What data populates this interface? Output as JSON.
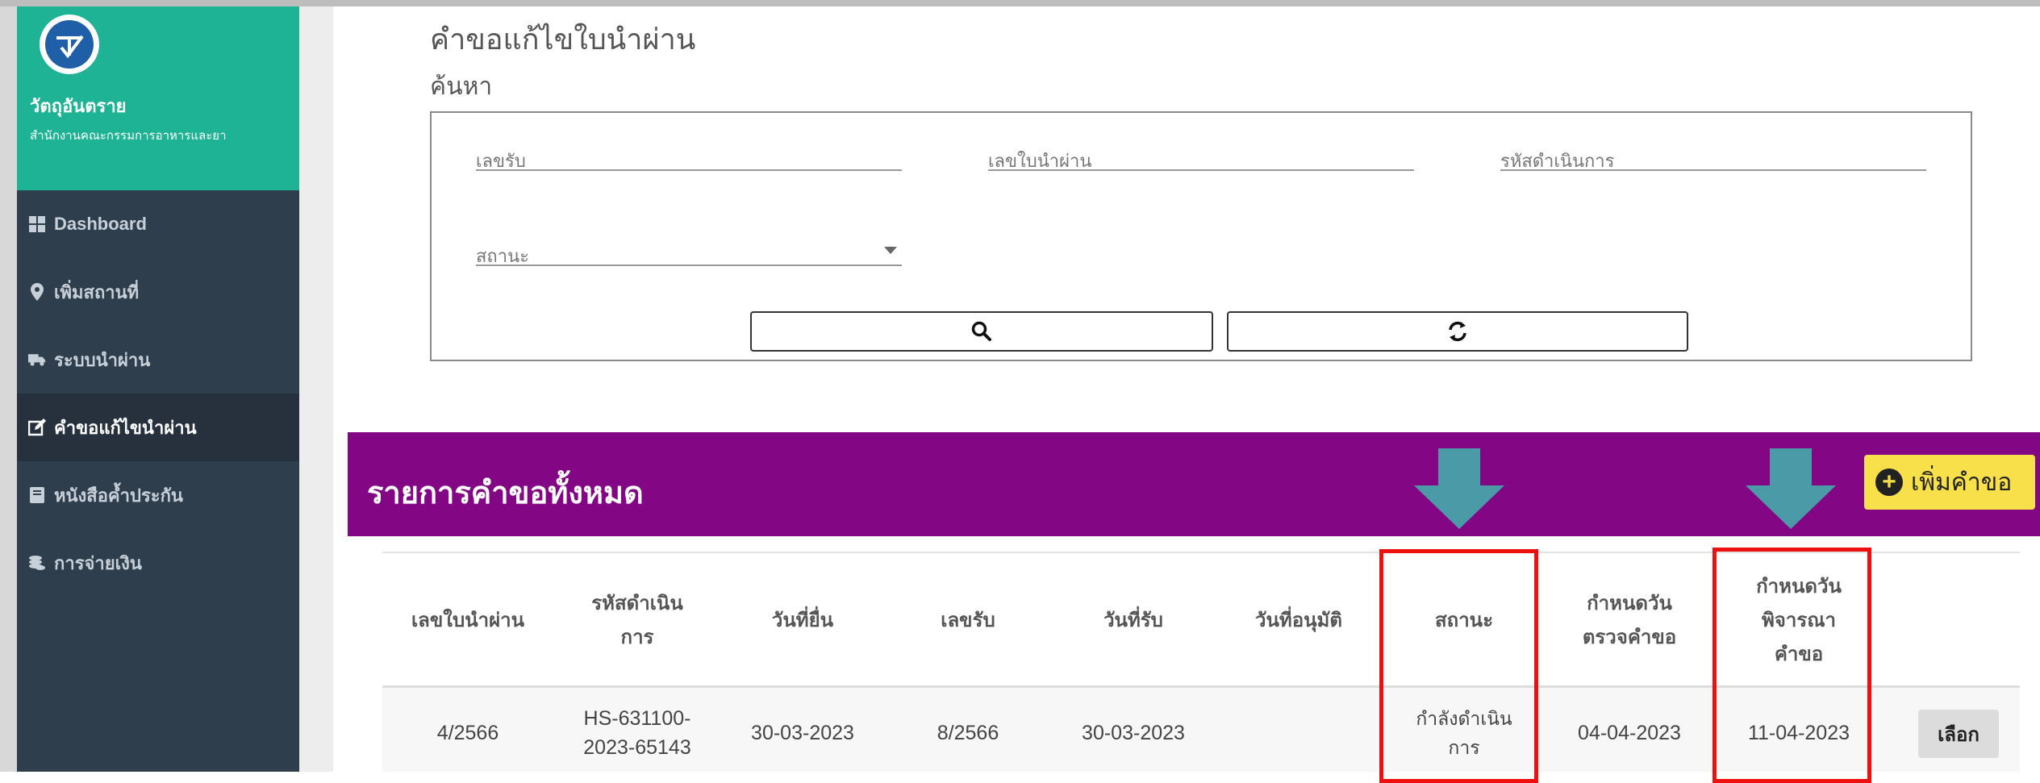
{
  "sidebar": {
    "brand_title": "วัตถุอันตราย",
    "brand_subtitle": "สำนักงานคณะกรรมการอาหารและยา",
    "items": [
      {
        "label": "Dashboard",
        "icon": "dashboard-icon"
      },
      {
        "label": "เพิ่มสถานที่",
        "icon": "map-marker-icon"
      },
      {
        "label": "ระบบนำผ่าน",
        "icon": "truck-icon"
      },
      {
        "label": "คำขอแก้ไขนำผ่าน",
        "icon": "edit-icon",
        "active": true
      },
      {
        "label": "หนังสือค้ำประกัน",
        "icon": "book-icon"
      },
      {
        "label": "การจ่ายเงิน",
        "icon": "coins-icon"
      }
    ]
  },
  "main": {
    "page_title": "คำขอแก้ไขใบนำผ่าน",
    "search_title": "ค้นหา",
    "search": {
      "receipt_no_placeholder": "เลขรับ",
      "permit_no_placeholder": "เลขใบนำผ่าน",
      "operation_code_placeholder": "รหัสดำเนินการ",
      "status_placeholder": "สถานะ",
      "search_icon": "search-icon",
      "reset_icon": "refresh-icon"
    },
    "list": {
      "title": "รายการคำขอทั้งหมด",
      "add_label": "เพิ่มคำขอ",
      "columns": [
        "เลขใบนำผ่าน",
        "รหัสดำเนิน\nการ",
        "วันที่ยื่น",
        "เลขรับ",
        "วันที่รับ",
        "วันที่อนุมัติ",
        "สถานะ",
        "กำหนดวัน\nตรวจคำขอ",
        "กำหนดวัน\nพิจารณา\nคำขอ"
      ],
      "rows": [
        {
          "permit_no": "4/2566",
          "operation_code": "HS-631100-\n2023-65143",
          "submit_date": "30-03-2023",
          "receipt_no": "8/2566",
          "receipt_date": "30-03-2023",
          "approve_date": "",
          "status": "กำลังดำเนิน\nการ",
          "check_due": "04-04-2023",
          "consider_due": "11-04-2023",
          "action_label": "เลือก"
        }
      ]
    }
  },
  "colors": {
    "brand_green": "#1db394",
    "sidebar_dark": "#2f3e4d",
    "header_purple": "#830784",
    "add_button_yellow": "#f7e04a",
    "highlight_red": "#ee0f0f",
    "annotation_arrow_teal": "#4a9aa8"
  }
}
